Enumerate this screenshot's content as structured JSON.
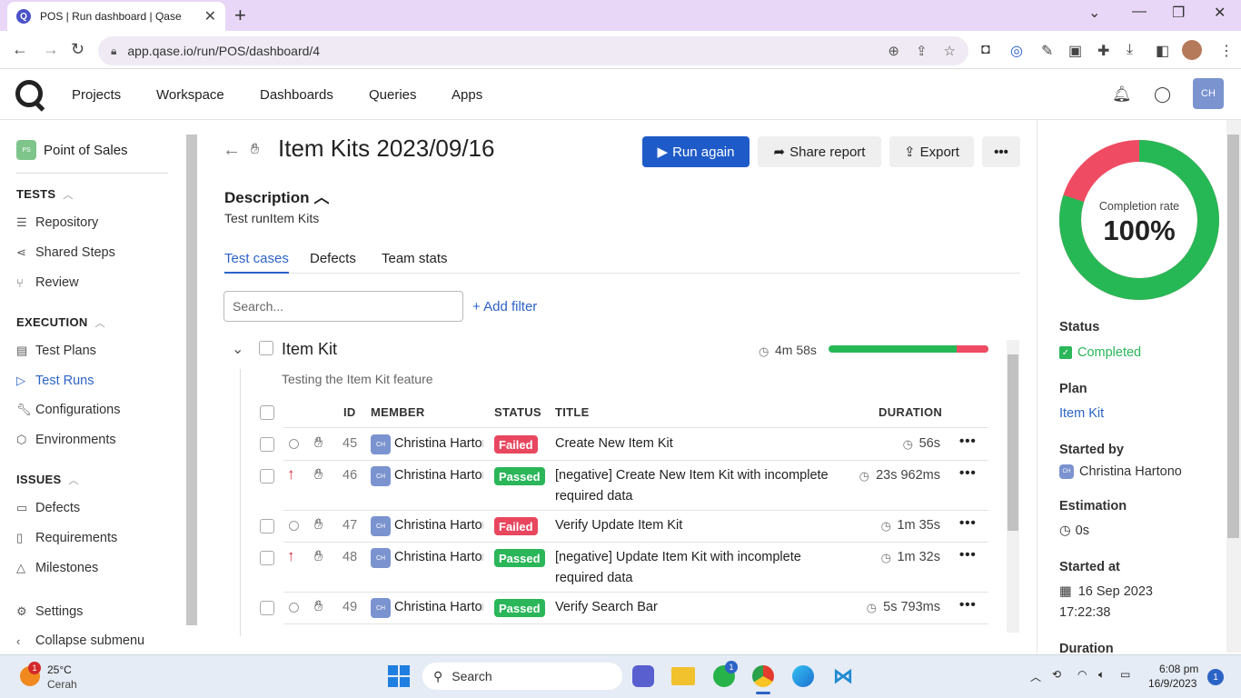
{
  "browser": {
    "tab_title": "POS | Run dashboard | Qase",
    "favicon": "Q",
    "url": "app.qase.io/run/POS/dashboard/4"
  },
  "nav": {
    "items": [
      "Projects",
      "Workspace",
      "Dashboards",
      "Queries",
      "Apps"
    ],
    "avatar": "CH"
  },
  "sidebar": {
    "project": {
      "badge": "PS",
      "name": "Point of Sales"
    },
    "tests_heading": "TESTS",
    "tests": [
      "Repository",
      "Shared Steps",
      "Review"
    ],
    "execution_heading": "EXECUTION",
    "execution": [
      "Test Plans",
      "Test Runs",
      "Configurations",
      "Environments"
    ],
    "issues_heading": "ISSUES",
    "issues": [
      "Defects",
      "Requirements",
      "Milestones"
    ],
    "settings": "Settings",
    "collapse": "Collapse submenu"
  },
  "run": {
    "title": "Item Kits 2023/09/16",
    "run_again": "Run again",
    "share": "Share report",
    "export": "Export",
    "more": "•••",
    "desc_heading": "Description",
    "desc": "Test runItem Kits",
    "tabs": [
      "Test cases",
      "Defects",
      "Team stats"
    ],
    "search_placeholder": "Search...",
    "add_filter": "+ Add filter"
  },
  "suite": {
    "title": "Item Kit",
    "duration": "4m 58s",
    "description": "Testing the Item Kit feature",
    "passed_fraction": 0.8
  },
  "table": {
    "headers": {
      "id": "ID",
      "member": "MEMBER",
      "status": "STATUS",
      "title": "TITLE",
      "duration": "DURATION"
    },
    "rows": [
      {
        "id": "45",
        "member": "Christina Hartono",
        "avatar": "CH",
        "status": "Failed",
        "title": "Create New Item Kit",
        "duration": "56s",
        "priority": "none"
      },
      {
        "id": "46",
        "member": "Christina Hartono",
        "avatar": "CH",
        "status": "Passed",
        "title": "[negative] Create New Item Kit with incomplete required data",
        "duration": "23s 962ms",
        "priority": "high"
      },
      {
        "id": "47",
        "member": "Christina Hartono",
        "avatar": "CH",
        "status": "Failed",
        "title": "Verify Update Item Kit",
        "duration": "1m 35s",
        "priority": "none"
      },
      {
        "id": "48",
        "member": "Christina Hartono",
        "avatar": "CH",
        "status": "Passed",
        "title": "[negative] Update Item Kit with incomplete required data",
        "duration": "1m 32s",
        "priority": "high"
      },
      {
        "id": "49",
        "member": "Christina Hartono",
        "avatar": "CH",
        "status": "Passed",
        "title": "Verify Search Bar",
        "duration": "5s 793ms",
        "priority": "none"
      }
    ]
  },
  "right": {
    "completion_label": "Completion rate",
    "completion_value": "100%",
    "completion_passed_fraction": 0.8,
    "status_label": "Status",
    "status": "Completed",
    "plan_label": "Plan",
    "plan": "Item Kit",
    "started_by_label": "Started by",
    "started_by": "Christina Hartono",
    "estimation_label": "Estimation",
    "estimation": "0s",
    "started_at_label": "Started at",
    "started_at_date": "16 Sep 2023",
    "started_at_time": "17:22:38",
    "duration_label": "Duration"
  },
  "taskbar": {
    "weather_temp": "25°C",
    "weather_desc": "Cerah",
    "weather_badge": "1",
    "search": "Search",
    "whatsapp_badge": "1",
    "time": "6:08 pm",
    "date": "16/9/2023",
    "notif": "1"
  },
  "colors": {
    "accent": "#1f5bc8",
    "passed": "#2ab659",
    "failed": "#e8475f"
  }
}
